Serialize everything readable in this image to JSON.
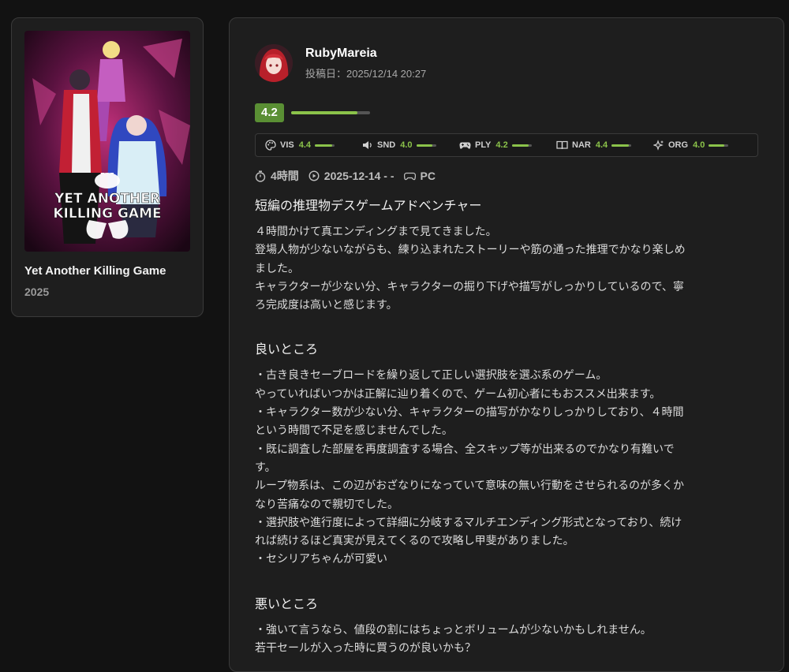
{
  "game": {
    "title": "Yet Another Killing Game",
    "year": "2025",
    "cover_logo_lines": [
      "YET ANOTHER",
      "KILLING GAME"
    ]
  },
  "review": {
    "author": "RubyMareia",
    "posted": "投稿日：2025/12/14 20:27",
    "score": "4.2",
    "score_fraction": 0.84,
    "metrics": [
      {
        "icon": "palette-icon",
        "label": "VIS",
        "value": "4.4",
        "fraction": 0.88
      },
      {
        "icon": "speaker-icon",
        "label": "SND",
        "value": "4.0",
        "fraction": 0.8
      },
      {
        "icon": "gamepad-icon",
        "label": "PLY",
        "value": "4.2",
        "fraction": 0.84
      },
      {
        "icon": "book-icon",
        "label": "NAR",
        "value": "4.4",
        "fraction": 0.88
      },
      {
        "icon": "sparkle-icon",
        "label": "ORG",
        "value": "4.0",
        "fraction": 0.8
      }
    ],
    "playtime": "4時間",
    "play_date": "2025-12-14 - -",
    "platform": "PC",
    "headline": "短編の推理物デスゲームアドベンチャー",
    "intro_lines": [
      "４時間かけて真エンディングまで見てきました。",
      "登場人物が少ないながらも、練り込まれたストーリーや筋の通った推理でかなり楽しめ",
      "ました。",
      "キャラクターが少ない分、キャラクターの掘り下げや描写がしっかりしているので、寧",
      "ろ完成度は高いと感じます。"
    ],
    "good_heading": "良いところ",
    "good_lines": [
      "・古き良きセーブロードを繰り返して正しい選択肢を選ぶ系のゲーム。",
      "やっていればいつかは正解に辿り着くので、ゲーム初心者にもおススメ出来ます。",
      "・キャラクター数が少ない分、キャラクターの描写がかなりしっかりしており、４時間",
      "という時間で不足を感じませんでした。",
      "・既に調査した部屋を再度調査する場合、全スキップ等が出来るのでかなり有難いで",
      "す。",
      "ループ物系は、この辺がおざなりになっていて意味の無い行動をさせられるのが多くか",
      "なり苦痛なので親切でした。",
      "・選択肢や進行度によって詳細に分岐するマルチエンディング形式となっており、続け",
      "れば続けるほど真実が見えてくるので攻略し甲斐がありました。",
      "・セシリアちゃんが可愛い"
    ],
    "bad_heading": "悪いところ",
    "bad_lines": [
      "・強いて言うなら、値段の割にはちょっとボリュームが少ないかもしれません。",
      "若干セールが入った時に買うのが良いかも？"
    ]
  },
  "colors": {
    "accent_green": "#8bc34a",
    "score_badge": "#5a8f34",
    "card_bg": "#1e1e1e",
    "page_bg": "#121212"
  }
}
